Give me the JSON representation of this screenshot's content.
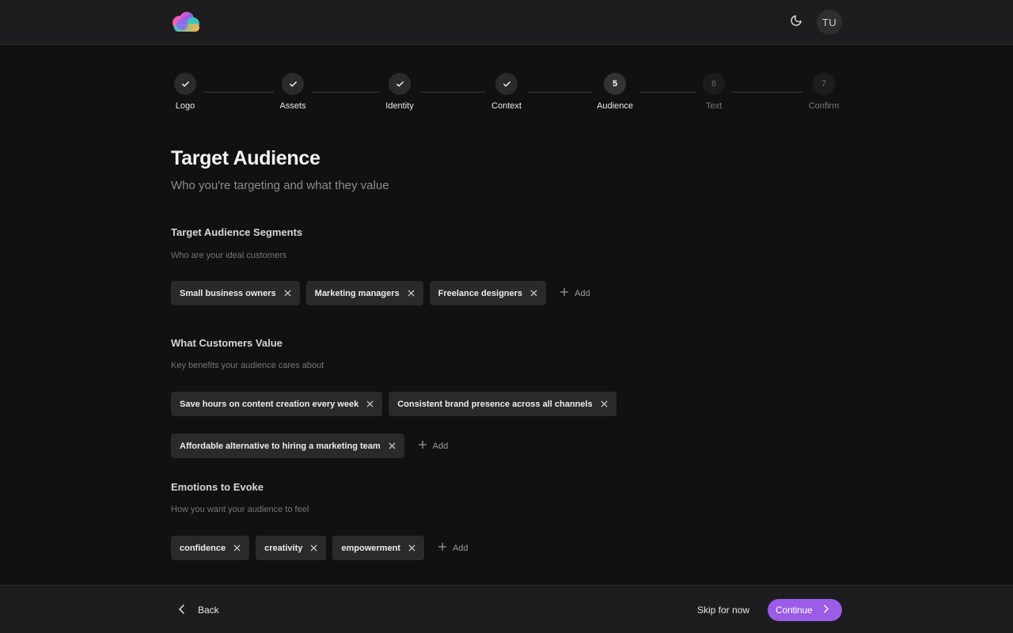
{
  "header": {
    "logo_icon": "cloud-logo-icon",
    "theme_icon": "moon-icon",
    "avatar_initials": "TU"
  },
  "stepper": {
    "steps": [
      {
        "label": "Logo",
        "number": "1",
        "state": "complete"
      },
      {
        "label": "Assets",
        "number": "2",
        "state": "complete"
      },
      {
        "label": "Identity",
        "number": "3",
        "state": "complete"
      },
      {
        "label": "Context",
        "number": "4",
        "state": "complete"
      },
      {
        "label": "Audience",
        "number": "5",
        "state": "current"
      },
      {
        "label": "Text",
        "number": "6",
        "state": "upcoming"
      },
      {
        "label": "Confirm",
        "number": "7",
        "state": "upcoming"
      }
    ]
  },
  "page": {
    "title": "Target Audience",
    "subtitle": "Who you're targeting and what they value"
  },
  "sections": {
    "segments": {
      "title": "Target Audience Segments",
      "description": "Who are your ideal customers",
      "tags": [
        "Small business owners",
        "Marketing managers",
        "Freelance designers"
      ],
      "add_label": "Add"
    },
    "values": {
      "title": "What Customers Value",
      "description": "Key benefits your audience cares about",
      "tags": [
        "Save hours on content creation every week",
        "Consistent brand presence across all channels",
        "Affordable alternative to hiring a marketing team"
      ],
      "add_label": "Add"
    },
    "emotions": {
      "title": "Emotions to Evoke",
      "description": "How you want your audience to feel",
      "tags": [
        "confidence",
        "creativity",
        "empowerment"
      ],
      "add_label": "Add"
    }
  },
  "footer": {
    "back_label": "Back",
    "skip_label": "Skip for now",
    "continue_label": "Continue"
  },
  "colors": {
    "accent": "#9b5ce8",
    "background": "#111112",
    "surface": "#1d1d1f",
    "tag": "#2a2a2d"
  }
}
